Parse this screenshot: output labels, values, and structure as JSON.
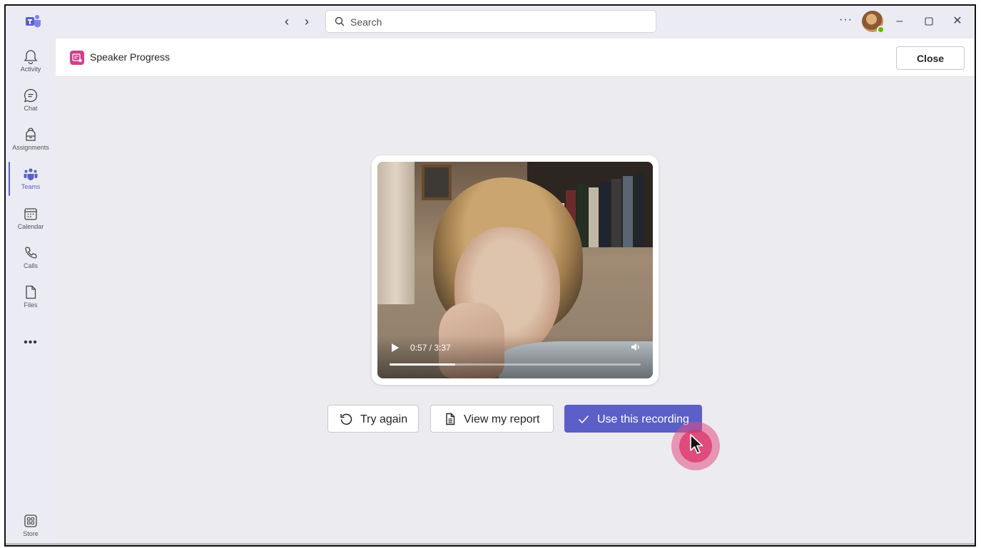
{
  "search": {
    "placeholder": "Search"
  },
  "rail": {
    "items": [
      {
        "label": "Activity",
        "icon": "bell-icon"
      },
      {
        "label": "Chat",
        "icon": "chat-icon"
      },
      {
        "label": "Assignments",
        "icon": "backpack-icon"
      },
      {
        "label": "Teams",
        "icon": "teams-icon",
        "active": true
      },
      {
        "label": "Calendar",
        "icon": "calendar-icon"
      },
      {
        "label": "Calls",
        "icon": "phone-icon"
      },
      {
        "label": "Files",
        "icon": "file-icon"
      }
    ],
    "more": "•••",
    "store": {
      "label": "Store",
      "icon": "store-icon"
    }
  },
  "titlebar": {
    "more": "···"
  },
  "app": {
    "title": "Speaker Progress",
    "close_label": "Close"
  },
  "video": {
    "time": "0:57 / 3:37",
    "progress": 0.262
  },
  "actions": {
    "try_again": "Try again",
    "view_report": "View my report",
    "use_recording": "Use this recording"
  },
  "colors": {
    "accent": "#5b5fc7",
    "app_icon": "#d13f8a",
    "cursor_highlight": "#e24f82"
  }
}
